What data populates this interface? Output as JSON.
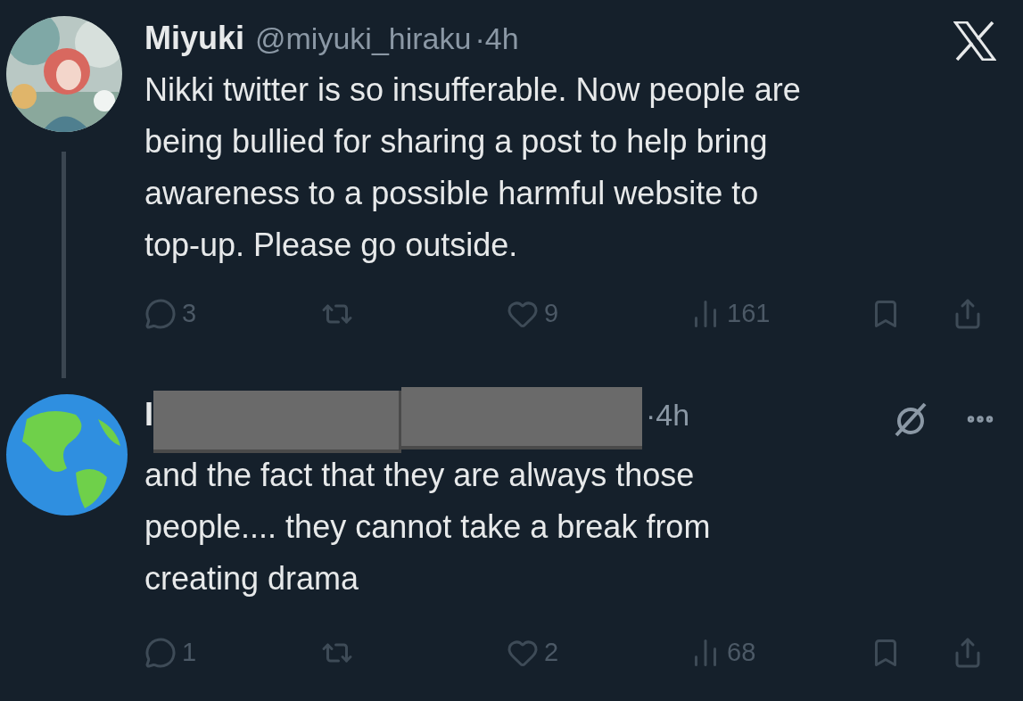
{
  "tweets": [
    {
      "author": {
        "name": "Miyuki",
        "handle": "@miyuki_hiraku",
        "redacted": false
      },
      "time": "·4h",
      "corner": {
        "kind": "logo"
      },
      "thread_line": true,
      "body_lines": [
        "Nikki twitter is so insufferable. Now people are",
        "being bullied for sharing a post to help bring",
        "awareness to a possible harmful website to",
        "top-up. Please go outside."
      ],
      "stats": {
        "replies": "3",
        "likes": "9",
        "views": "161"
      }
    },
    {
      "author": {
        "name": "I",
        "redacted": true
      },
      "time": "·4h",
      "avatar": {
        "kind": "globe"
      },
      "corner": {
        "kind": "actions"
      },
      "thread_line": false,
      "body_lines": [
        "and the fact that they are always those",
        "people.... they cannot take a break from",
        "creating drama"
      ],
      "stats": {
        "replies": "1",
        "likes": "2",
        "views": "68"
      }
    }
  ]
}
